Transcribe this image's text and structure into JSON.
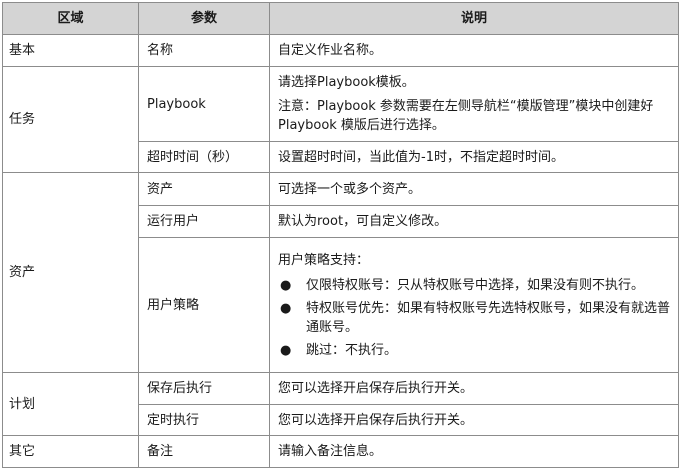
{
  "headers": {
    "area": "区域",
    "param": "参数",
    "desc": "说明"
  },
  "sections": {
    "basic": {
      "area": "基本",
      "rows": [
        {
          "param": "名称",
          "desc": "自定义作业名称。"
        }
      ]
    },
    "task": {
      "area": "任务",
      "rows": [
        {
          "param": "Playbook",
          "desc": "请选择Playbook模板。",
          "note": "注意：Playbook 参数需要在左侧导航栏“模版管理”模块中创建好 Playbook 模版后进行选择。"
        },
        {
          "param": "超时时间（秒）",
          "desc": "设置超时时间，当此值为-1时，不指定超时时间。"
        }
      ]
    },
    "asset": {
      "area": "资产",
      "rows": [
        {
          "param": "资产",
          "desc": "可选择一个或多个资产。"
        },
        {
          "param": "运行用户",
          "desc": "默认为root，可自定义修改。"
        },
        {
          "param": "用户策略",
          "desc": "用户策略支持：",
          "bullet_symbol": "●",
          "options": [
            "仅限特权账号：只从特权账号中选择，如果没有则不执行。",
            "特权账号优先：如果有特权账号先选特权账号，如果没有就选普通账号。",
            "跳过：不执行。"
          ]
        }
      ]
    },
    "plan": {
      "area": "计划",
      "rows": [
        {
          "param": "保存后执行",
          "desc": "您可以选择开启保存后执行开关。"
        },
        {
          "param": "定时执行",
          "desc": "您可以选择开启保存后执行开关。"
        }
      ]
    },
    "other": {
      "area": "其它",
      "rows": [
        {
          "param": "备注",
          "desc": "请输入备注信息。"
        }
      ]
    }
  }
}
